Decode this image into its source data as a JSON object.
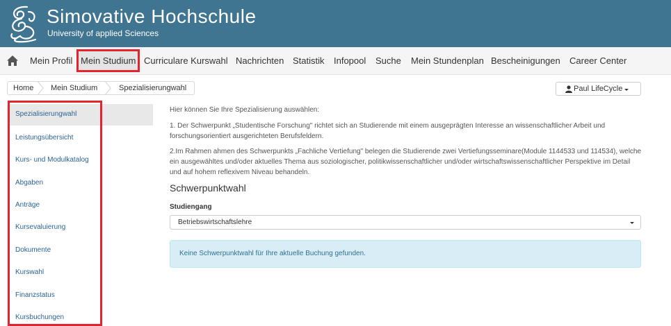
{
  "header": {
    "title": "Simovative Hochschule",
    "subtitle": "University of applied Sciences"
  },
  "nav": {
    "items": [
      "Mein Profil",
      "Mein Studium",
      "Curriculare Kurswahl",
      "Nachrichten",
      "Statistik",
      "Infopool",
      "Suche",
      "Mein Stundenplan",
      "Bescheinigungen",
      "Career Center"
    ],
    "active_item": "Mein Studium"
  },
  "breadcrumb": [
    "Home",
    "Mein Studium",
    "Spezialisierungwahl"
  ],
  "user": {
    "name": "Paul LifeCycle"
  },
  "sidebar": {
    "items": [
      "Spezialisierungwahl",
      "Leistungsübersicht",
      "Kurs- und Modulkatalog",
      "Abgaben",
      "Anträge",
      "Kursevaluierung",
      "Dokumente",
      "Kurswahl",
      "Finanzstatus",
      "Kursbuchungen"
    ],
    "active_item": "Spezialisierungwahl"
  },
  "main": {
    "intro": "Hier können Sie Ihre Spezialisierung auswählen:",
    "point1": "1. Der Schwerpunkt „Studentische Forschung\" richtet sich an Studierende mit einem ausgeprägten Interesse an wissenschaftlicher Arbeit und forschungsorientiert ausgerichteten Berufsfeldern.",
    "point2": "2.Im Rahmen ahmen des Schwerpunkts „Fachliche Vertiefung\" belegen die Studierende zwei Vertiefungsseminare(Module 1144533 und 114534), welche ein ausgewähltes und/oder aktuelles Thema aus soziologischer, politikwissenschaftlicher und/oder wirtschaftswissenschaftlicher Perspektive im Detail und auf hohem reflexivem Niveau behandeln.",
    "section_title": "Schwerpunktwahl",
    "field_label": "Studiengang",
    "select_value": "Betriebswirtschaftslehre",
    "alert": "Keine Schwerpunktwahl für Ihre aktuelle Buchung gefunden."
  },
  "colors": {
    "header_bg": "#3f7591",
    "highlight_frame": "#e3232d",
    "link": "#2a6496",
    "alert_bg": "#d9edf7",
    "alert_text": "#31708f"
  }
}
